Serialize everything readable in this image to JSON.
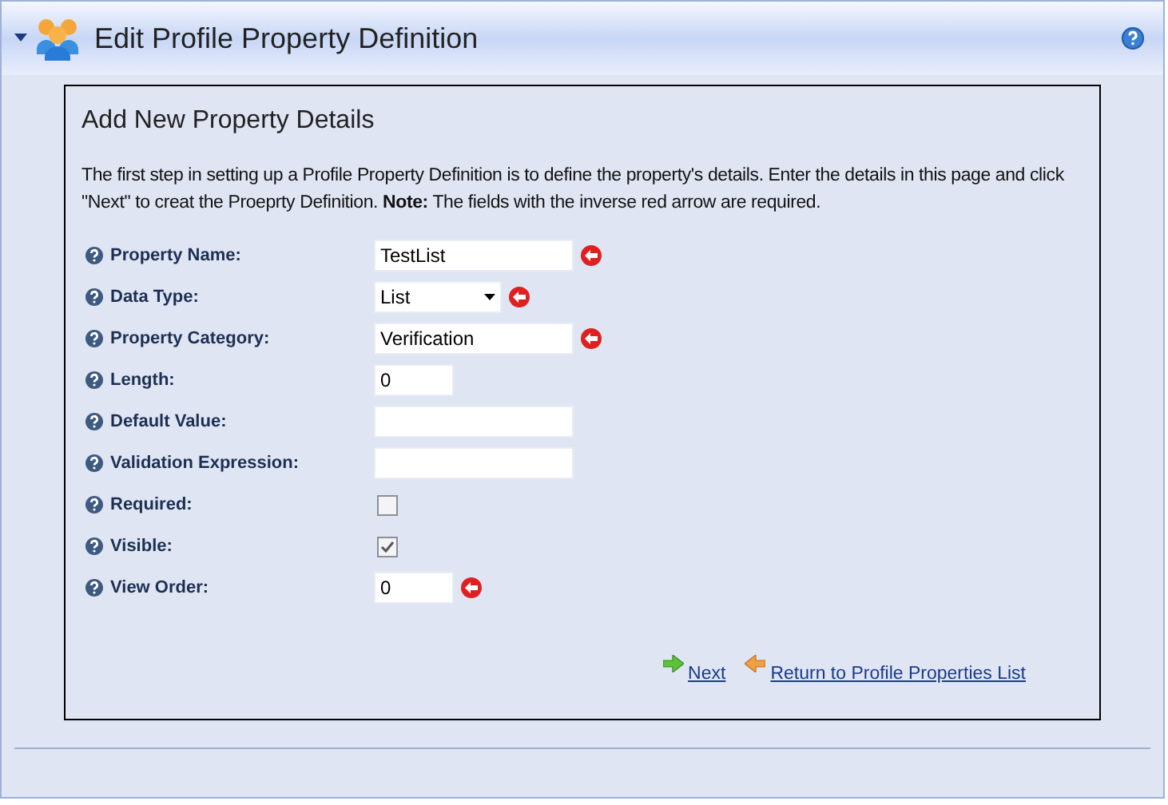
{
  "header": {
    "title": "Edit Profile Property Definition"
  },
  "section": {
    "title": "Add New Property Details",
    "intro": "The first step in setting up a Profile Property Definition is to define the property's details. Enter the details in this page and click \"Next\" to creat the Proeprty Definition. **Note:** The fields with the inverse red arrow are required.",
    "fields": [
      {
        "label": "Property Name:",
        "kind": "text",
        "value": "TestList",
        "required": true
      },
      {
        "label": "Data Type:",
        "kind": "select",
        "value": "List",
        "required": true
      },
      {
        "label": "Property Category:",
        "kind": "text",
        "value": "Verification",
        "required": true
      },
      {
        "label": "Length:",
        "kind": "short_text",
        "value": "0",
        "required": false
      },
      {
        "label": "Default Value:",
        "kind": "text",
        "required": false
      },
      {
        "label": "Validation Expression:",
        "kind": "text",
        "required": false
      },
      {
        "label": "Required:",
        "kind": "checkbox",
        "checked": false
      },
      {
        "label": "Visible:",
        "kind": "checkbox",
        "checked": true
      },
      {
        "label": "View Order:",
        "kind": "short_text",
        "value": "0",
        "required": true
      }
    ],
    "links": [
      {
        "label": "Next",
        "kind": "next"
      },
      {
        "label": "Return to Profile Properties List",
        "kind": "return"
      }
    ]
  }
}
